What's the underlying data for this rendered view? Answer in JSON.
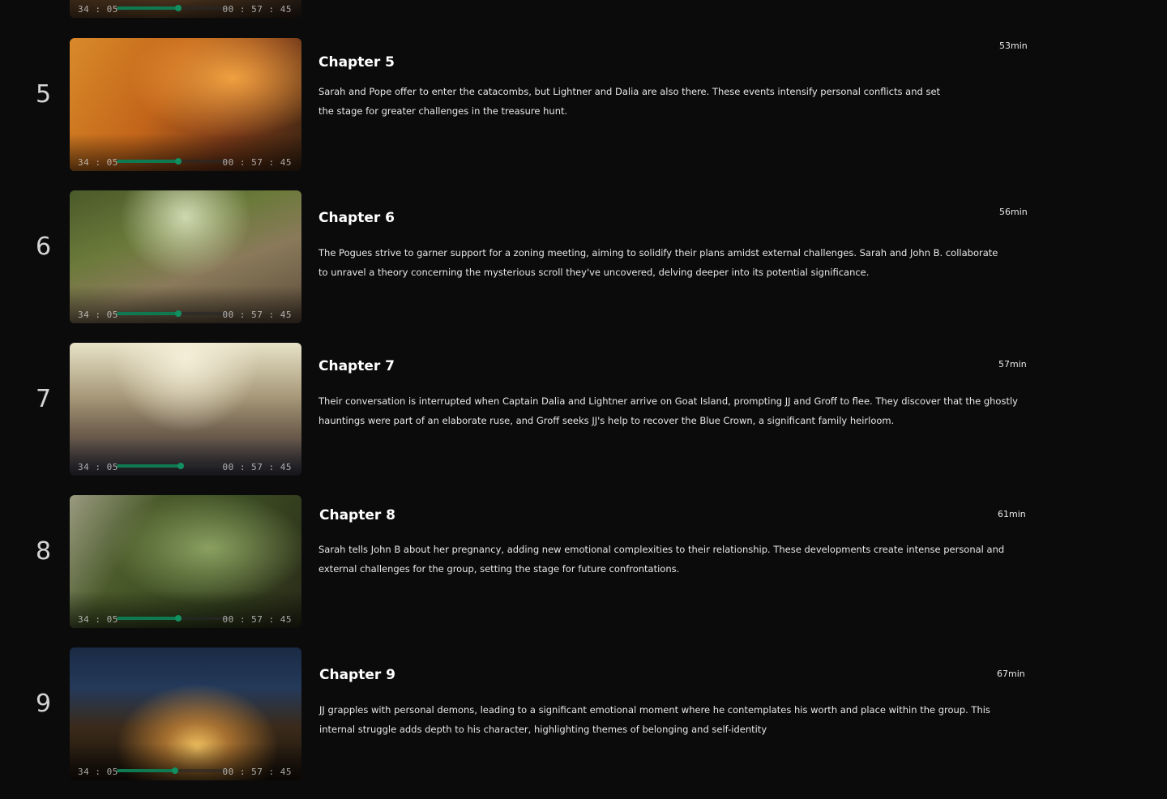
{
  "partial_episode": {
    "time_elapsed": "34 : 05",
    "time_total": "00 : 57 : 45",
    "progress": 0.55
  },
  "episodes": [
    {
      "number": "5",
      "title": "Chapter 5",
      "duration": "53min",
      "description": "Sarah and Pope offer to enter the catacombs, but Lightner and Dalia are also there. These events intensify personal conflicts and set the stage for greater challenges in the treasure hunt.",
      "time_elapsed": "34 : 05",
      "time_total": "00 : 57 : 45",
      "progress": 0.55
    },
    {
      "number": "6",
      "title": "Chapter 6",
      "duration": "56min",
      "description": "The Pogues strive to garner support for a zoning meeting, aiming to solidify their plans amidst external challenges. Sarah and John B. collaborate to unravel a theory concerning the mysterious scroll they've uncovered, delving deeper into its potential significance.",
      "time_elapsed": "34 : 05",
      "time_total": "00 : 57 : 45",
      "progress": 0.55
    },
    {
      "number": "7",
      "title": "Chapter 7",
      "duration": "57min",
      "description": "Their conversation is interrupted when Captain Dalia and Lightner arrive on Goat Island, prompting JJ and Groff to flee. They discover that the ghostly hauntings were part of an elaborate ruse, and Groff seeks JJ's help to recover the Blue Crown, a significant family heirloom.",
      "time_elapsed": "34 : 05",
      "time_total": "00 : 57 : 45",
      "progress": 0.57
    },
    {
      "number": "8",
      "title": "Chapter 8",
      "duration": "61min",
      "description": "Sarah tells John B about her pregnancy, adding new emotional complexities to their relationship. These developments create intense personal and external challenges for the group, setting the stage for future confrontations.",
      "time_elapsed": "34 : 05",
      "time_total": "00 : 57 : 45",
      "progress": 0.55
    },
    {
      "number": "9",
      "title": "Chapter 9",
      "duration": "67min",
      "description": "JJ grapples with personal demons, leading to a significant emotional moment where he contemplates his worth and place within the group. This internal struggle adds depth to his character, highlighting themes of belonging and self-identity",
      "time_elapsed": "34 : 05",
      "time_total": "00 : 57 : 45",
      "progress": 0.52
    }
  ],
  "colors": {
    "background": "#0b0b0c",
    "progress_accent": "#0f7a52"
  }
}
